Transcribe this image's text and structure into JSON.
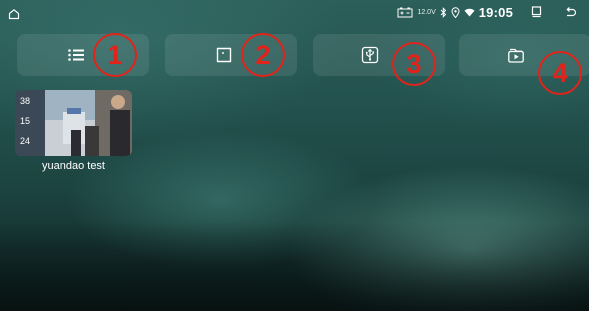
{
  "status_bar": {
    "home_icon": "home-icon",
    "battery_icon": "car-battery-icon",
    "voltage": "12.0V",
    "bluetooth_icon": "bluetooth-icon",
    "location_icon": "location-pin-icon",
    "wifi_icon": "wifi-icon",
    "time": "19:05",
    "recent_apps_icon": "recent-apps-icon",
    "back_icon": "back-arrow-icon"
  },
  "tabs": [
    {
      "icon": "list-icon",
      "marker": "1"
    },
    {
      "icon": "sd-card-icon",
      "marker": "2"
    },
    {
      "icon": "usb-icon",
      "marker": "3"
    },
    {
      "icon": "video-folder-icon",
      "marker": "4"
    }
  ],
  "videos": [
    {
      "title": "yuandao test",
      "thumb_text": [
        "38",
        "15",
        "24"
      ]
    }
  ],
  "colors": {
    "marker": "#e2231a",
    "tab_bg": "rgba(255,255,255,0.09)",
    "background": "#23514d"
  }
}
